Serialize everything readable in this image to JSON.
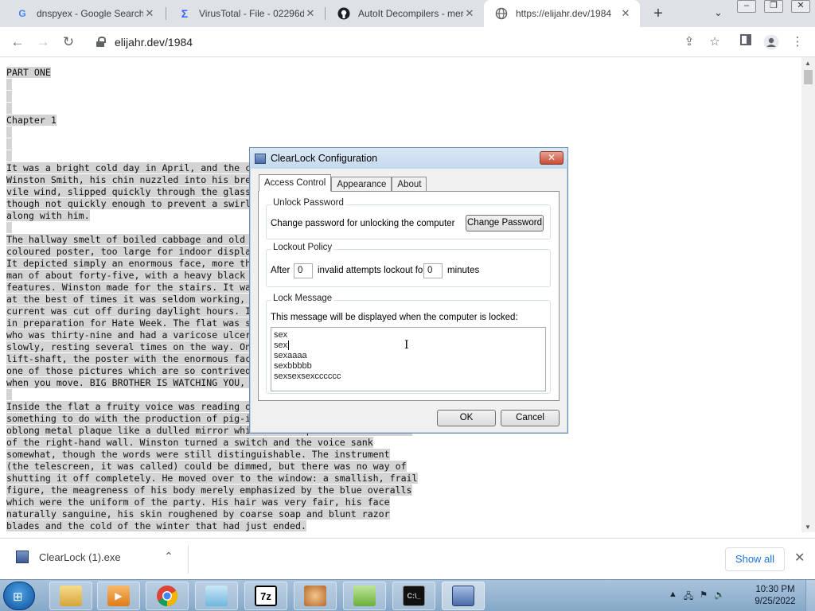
{
  "browser": {
    "tabs": [
      {
        "title": "dnspyex - Google Search",
        "icon": "google-icon"
      },
      {
        "title": "VirusTotal - File - 02296d",
        "icon": "virustotal-icon"
      },
      {
        "title": "AutoIt Decompilers - mer",
        "icon": "github-icon"
      },
      {
        "title": "https://elijahr.dev/1984",
        "icon": "globe-icon"
      }
    ],
    "url": "elijahr.dev/1984"
  },
  "page": {
    "lines": [
      "PART ONE",
      "",
      "",
      "",
      "Chapter 1",
      "",
      "",
      "",
      "It was a bright cold day in April, and the clocks were striking thirteen.",
      "Winston Smith, his chin nuzzled into his breast in an effort to escape the",
      "vile wind, slipped quickly through the glass doors of Victory Mansions,",
      "though not quickly enough to prevent a swirl of gritty dust from entering",
      "along with him.",
      "",
      "The hallway smelt of boiled cabbage and old rag mats. At one end of it a",
      "coloured poster, too large for indoor display, had been tacked to the wall.",
      "It depicted simply an enormous face, more than a metre wide: the face of a",
      "man of about forty-five, with a heavy black moustache and ruggedly handsome",
      "features. Winston made for the stairs. It was no use trying the lift. Even",
      "at the best of times it was seldom working, and at present the electric",
      "current was cut off during daylight hours. It was part of the economy drive",
      "in preparation for Hate Week. The flat was seven flights up, and Winston,",
      "who was thirty-nine and had a varicose ulcer above his right ankle, went",
      "slowly, resting several times on the way. On each landing, opposite the",
      "lift-shaft, the poster with the enormous face gazed from the wall. It was",
      "one of those pictures which are so contrived that the eyes follow you about",
      "when you move. BIG BROTHER IS WATCHING YOU, the caption beneath it ran.",
      "",
      "Inside the flat a fruity voice was reading out a list of figures which had",
      "something to do with the production of pig-iron. The voice came from an",
      "oblong metal plaque like a dulled mirror which formed part of the surface",
      "of the right-hand wall. Winston turned a switch and the voice sank",
      "somewhat, though the words were still distinguishable. The instrument",
      "(the telescreen, it was called) could be dimmed, but there was no way of",
      "shutting it off completely. He moved over to the window: a smallish, frail",
      "figure, the meagreness of his body merely emphasized by the blue overalls",
      "which were the uniform of the party. His hair was very fair, his face",
      "naturally sanguine, his skin roughened by coarse soap and blunt razor",
      "blades and the cold of the winter that had just ended."
    ]
  },
  "dialog": {
    "title": "ClearLock Configuration",
    "tabs": [
      "Access Control",
      "Appearance",
      "About"
    ],
    "unlock_group": "Unlock Password",
    "unlock_desc": "Change password for unlocking the computer",
    "change_password": "Change Password",
    "lockout_group": "Lockout Policy",
    "after": "After",
    "attempts_value": "0",
    "invalid_text": "invalid attempts lockout for",
    "minutes_value": "0",
    "minutes": "minutes",
    "message_group": "Lock Message",
    "message_desc": "This message will be displayed when the computer is locked:",
    "message_lines": [
      "sex",
      "sex",
      "sexaaaa",
      "sexbbbbb",
      "sexsexsexcccccc"
    ],
    "ok": "OK",
    "cancel": "Cancel"
  },
  "downloads": {
    "file": "ClearLock (1).exe",
    "show_all": "Show all"
  },
  "taskbar": {
    "apps": [
      "explorer-icon",
      "media-player-icon",
      "chrome-icon",
      "notepad-icon",
      "7zip-icon",
      "app-icon",
      "notepadpp-icon",
      "cmd-icon",
      "clearlock-icon"
    ],
    "app_labels": {
      "sevenzip": "7z"
    },
    "time": "10:30 PM",
    "date": "9/25/2022"
  }
}
